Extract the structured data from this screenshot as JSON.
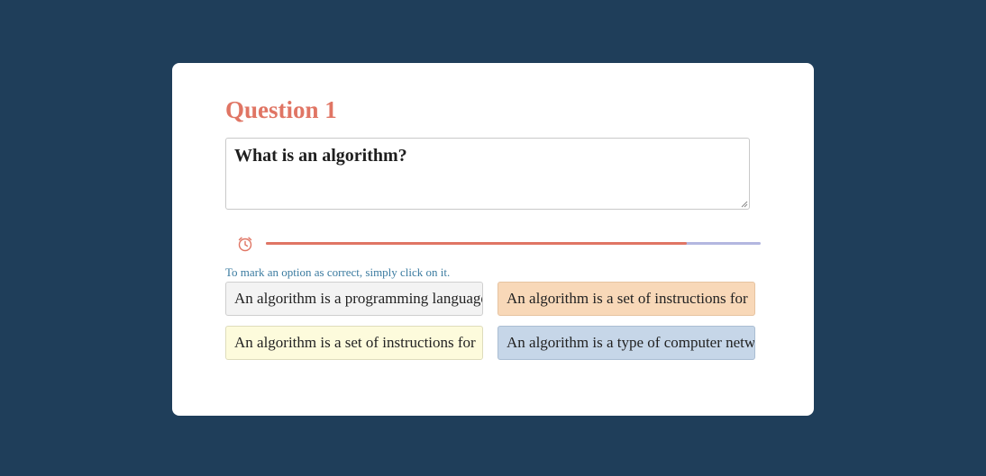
{
  "question": {
    "title": "Question 1",
    "text": "What is an algorithm?"
  },
  "timer": {
    "icon": "alarm-clock-icon",
    "progress_fraction": 0.85,
    "fill_color": "#e07564",
    "track_color": "#b3b7e0"
  },
  "hint": "To mark an option as correct, simply click on it.",
  "options": [
    {
      "label": "An algorithm is a programming language",
      "color": "#f3f3f3"
    },
    {
      "label": "An algorithm is a set of instructions for",
      "color": "#f8d8b8"
    },
    {
      "label": "An algorithm is a set of instructions for",
      "color": "#fdfbdc"
    },
    {
      "label": "An algorithm is a type of computer network",
      "color": "#c6d6e8"
    }
  ],
  "colors": {
    "background": "#1f3e5a",
    "card": "#ffffff",
    "accent": "#e07564",
    "hint": "#3b7ba0"
  }
}
